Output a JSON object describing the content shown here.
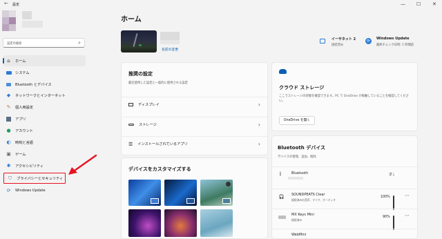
{
  "window": {
    "title": "設定",
    "back": "←",
    "minimize": "—",
    "maximize": "☐",
    "close": "✕"
  },
  "search": {
    "placeholder": "設定の検索"
  },
  "sidebar": {
    "items": [
      {
        "label": "ホーム",
        "icon": "home-icon"
      },
      {
        "label": "システム",
        "icon": "system-icon"
      },
      {
        "label": "Bluetooth とデバイス",
        "icon": "bluetooth-devices-icon"
      },
      {
        "label": "ネットワークとインターネット",
        "icon": "network-icon"
      },
      {
        "label": "個人用設定",
        "icon": "personalization-icon"
      },
      {
        "label": "アプリ",
        "icon": "apps-icon"
      },
      {
        "label": "アカウント",
        "icon": "accounts-icon"
      },
      {
        "label": "時刻と言語",
        "icon": "time-language-icon"
      },
      {
        "label": "ゲーム",
        "icon": "gaming-icon"
      },
      {
        "label": "アクセシビリティ",
        "icon": "accessibility-icon"
      },
      {
        "label": "プライバシーとセキュリティ",
        "icon": "privacy-shield-icon"
      },
      {
        "label": "Windows Update",
        "icon": "windows-update-icon"
      }
    ]
  },
  "main": {
    "title": "ホーム",
    "rename": "名前の変更",
    "status": [
      {
        "title": "イーサネット 2",
        "sub": "接続済み"
      },
      {
        "title": "Windows Update",
        "sub": "最終チェック日時: 1 時間前"
      }
    ],
    "recommended": {
      "title": "推奨の設定",
      "sub": "最近使用した設定と一般的に使用される設定",
      "items": [
        {
          "label": "ディスプレイ"
        },
        {
          "label": "ストレージ"
        },
        {
          "label": "インストールされているアプリ"
        }
      ]
    },
    "customize": {
      "title": "デバイスをカスタマイズする"
    },
    "cloud": {
      "title": "クラウド ストレージ",
      "desc": "ここでストレージの状態を確認できます。PC で OneDrive が稼働していることを確認してください。",
      "button": "OneDrive を開く"
    },
    "bluetooth": {
      "title": "Bluetooth デバイス",
      "sub": "デバイスの管理、追加、削除",
      "toggle_label": "Bluetooth",
      "toggle_state": "オン",
      "devices": [
        {
          "name": "SOUNDPEATS Clear",
          "status": "接続済みの音声、マイク、オーディオ",
          "battery": "100%"
        },
        {
          "name": "MX Keys Mini",
          "status": "接続済み",
          "battery": "90%"
        },
        {
          "name": "WebMini",
          "status": "",
          "battery": ""
        }
      ]
    }
  },
  "colors": {
    "accent": "#0a5fb4",
    "highlight": "#e81123",
    "selected": "#e9e9e9"
  }
}
